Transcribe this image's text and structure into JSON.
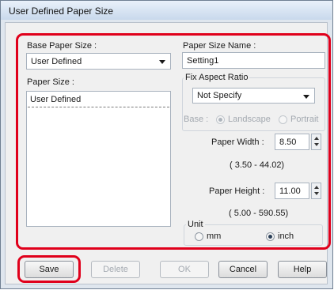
{
  "window": {
    "title": "User Defined Paper Size"
  },
  "left": {
    "base_paper_size_label": "Base Paper Size :",
    "base_paper_size_value": "User Defined",
    "paper_size_label": "Paper Size :",
    "paper_size_items": [
      "User Defined"
    ]
  },
  "right": {
    "paper_size_name_label": "Paper Size Name :",
    "paper_size_name_value": "Setting1",
    "fix_aspect_ratio_label": "Fix Aspect Ratio",
    "fix_aspect_ratio_value": "Not Specify",
    "base_label": "Base :",
    "landscape_label": "Landscape",
    "portrait_label": "Portrait",
    "paper_width_label": "Paper Width :",
    "paper_width_value": "8.50",
    "paper_width_range": "( 3.50 - 44.02)",
    "paper_height_label": "Paper Height :",
    "paper_height_value": "11.00",
    "paper_height_range": "( 5.00 - 590.55)",
    "unit_label": "Unit",
    "unit_mm_label": "mm",
    "unit_inch_label": "inch",
    "unit_selected": "inch"
  },
  "buttons": {
    "save": "Save",
    "delete": "Delete",
    "ok": "OK",
    "cancel": "Cancel",
    "help": "Help"
  },
  "colors": {
    "highlight": "#e0001b",
    "dialog_frame": "#dfe6ee"
  }
}
